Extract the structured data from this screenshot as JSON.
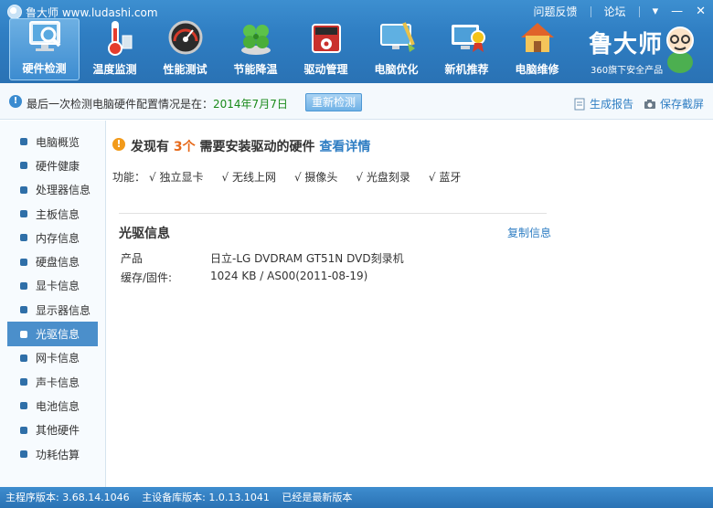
{
  "titlebar": {
    "app_title": "鲁大师 www.ludashi.com",
    "feedback": "问题反馈",
    "forum": "论坛",
    "menu_icon": "dropdown-arrow-icon",
    "minimize_icon": "minimize-icon",
    "close_icon": "close-icon"
  },
  "toolbar": [
    {
      "label": "硬件检测",
      "icon": "monitor-magnifier-icon",
      "active": true
    },
    {
      "label": "温度监测",
      "icon": "thermometer-icon",
      "active": false
    },
    {
      "label": "性能测试",
      "icon": "speedometer-icon",
      "active": false
    },
    {
      "label": "节能降温",
      "icon": "clover-icon",
      "active": false
    },
    {
      "label": "驱动管理",
      "icon": "gear-box-icon",
      "active": false
    },
    {
      "label": "电脑优化",
      "icon": "broom-monitor-icon",
      "active": false
    },
    {
      "label": "新机推荐",
      "icon": "medal-monitor-icon",
      "active": false
    },
    {
      "label": "电脑维修",
      "icon": "house-icon",
      "active": false
    }
  ],
  "brand": {
    "name": "鲁大师",
    "subtitle": "360旗下安全产品"
  },
  "infobar": {
    "text": "最后一次检测电脑硬件配置情况是在：",
    "date": "2014年7月7日",
    "rescan": "重新检测",
    "report": "生成报告",
    "screenshot": "保存截屏"
  },
  "sidebar": [
    {
      "label": "电脑概览",
      "active": false
    },
    {
      "label": "硬件健康",
      "active": false
    },
    {
      "label": "处理器信息",
      "active": false
    },
    {
      "label": "主板信息",
      "active": false
    },
    {
      "label": "内存信息",
      "active": false
    },
    {
      "label": "硬盘信息",
      "active": false
    },
    {
      "label": "显卡信息",
      "active": false
    },
    {
      "label": "显示器信息",
      "active": false
    },
    {
      "label": "光驱信息",
      "active": true
    },
    {
      "label": "网卡信息",
      "active": false
    },
    {
      "label": "声卡信息",
      "active": false
    },
    {
      "label": "电池信息",
      "active": false
    },
    {
      "label": "其他硬件",
      "active": false
    },
    {
      "label": "功耗估算",
      "active": false
    }
  ],
  "main": {
    "warning_prefix": "发现有",
    "warning_count": "3个",
    "warning_suffix": "需要安装驱动的硬件",
    "warning_link": "查看详情",
    "features_label": "功能：",
    "features": [
      "√ 独立显卡",
      "√ 无线上网",
      "√ 摄像头",
      "√ 光盘刻录",
      "√ 蓝牙"
    ],
    "section_title": "光驱信息",
    "copy_label": "复制信息",
    "rows": [
      {
        "key": "产品",
        "value": "日立-LG DVDRAM GT51N DVD刻录机"
      },
      {
        "key": "缓存/固件:",
        "value": "1024 KB / AS00(2011-08-19)"
      }
    ]
  },
  "footer": {
    "program_version": "主程序版本: 3.68.14.1046",
    "db_version": "主设备库版本: 1.0.13.1041",
    "status": "已经是最新版本"
  }
}
